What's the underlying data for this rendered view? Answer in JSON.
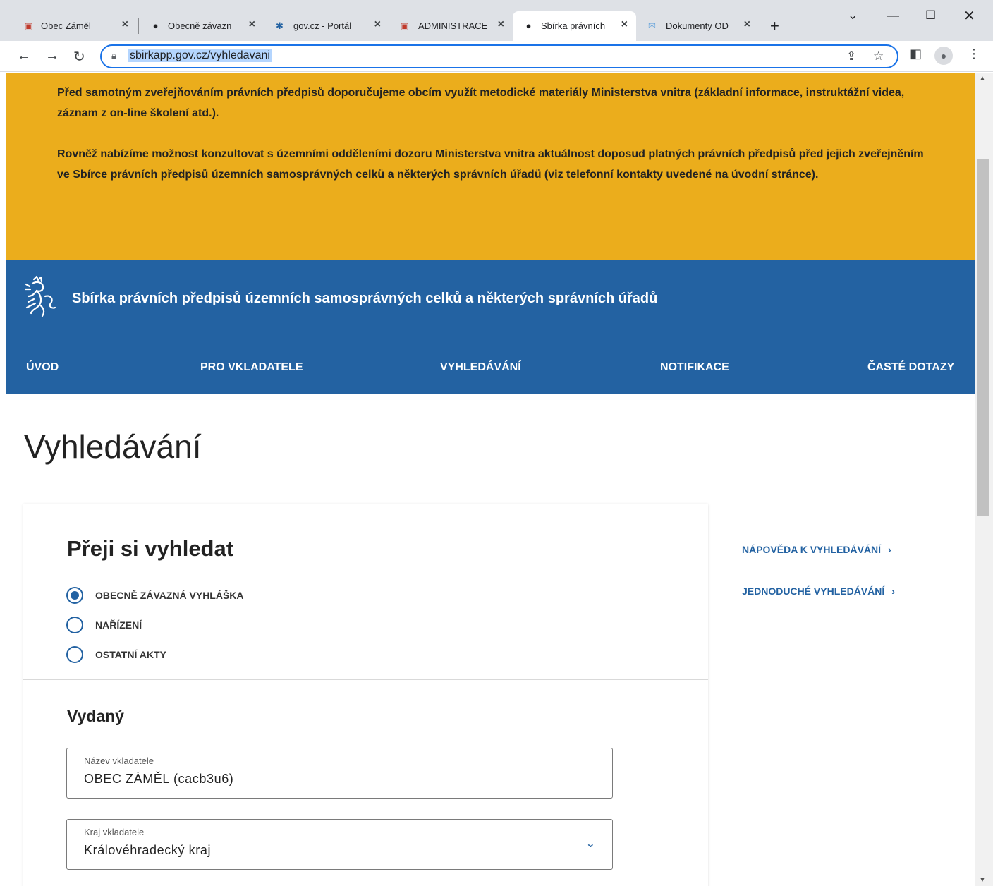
{
  "browser": {
    "tabs": [
      {
        "title": "Obec Záměl",
        "icon": "obec-icon",
        "active": false
      },
      {
        "title": "Obecně závazn",
        "icon": "globe-icon",
        "active": false
      },
      {
        "title": "gov.cz - Portál",
        "icon": "gov-icon",
        "active": false
      },
      {
        "title": "ADMINISTRACE",
        "icon": "obec-icon",
        "active": false
      },
      {
        "title": "Sbírka právních",
        "icon": "globe-icon",
        "active": true
      },
      {
        "title": "Dokumenty OD",
        "icon": "mail-icon",
        "active": false
      }
    ],
    "url": "sbirkapp.gov.cz/vyhledavani"
  },
  "notice": {
    "paragraph1": "Před samotným zveřejňováním právních předpisů doporučujeme obcím využít metodické materiály Ministerstva vnitra (základní informace, instruktážní videa, záznam z on-line školení atd.).",
    "paragraph2": "Rovněž nabízíme možnost konzultovat s územními odděleními dozoru Ministerstva vnitra aktuálnost doposud platných právních předpisů před jejich zveřejněním ve Sbírce právních předpisů územních samosprávných celků a některých správních úřadů (viz telefonní kontakty uvedené na úvodní stránce)."
  },
  "header": {
    "site_title": "Sbírka právních předpisů územních samosprávných celků a některých správních úřadů",
    "nav": [
      "ÚVOD",
      "PRO VKLADATELE",
      "VYHLEDÁVÁNÍ",
      "NOTIFIKACE",
      "ČASTÉ DOTAZY"
    ]
  },
  "main": {
    "page_title": "Vyhledávání",
    "card_title": "Přeji si vyhledat",
    "radios": [
      {
        "label": "OBECNĚ ZÁVAZNÁ VYHLÁŠKA",
        "selected": true
      },
      {
        "label": "NAŘÍZENÍ",
        "selected": false
      },
      {
        "label": "OSTATNÍ AKTY",
        "selected": false
      }
    ],
    "section_title": "Vydaný",
    "fields": {
      "submitter_name_label": "Název vkladatele",
      "submitter_name_value": "OBEC ZÁMĚL (cacb3u6)",
      "region_label": "Kraj vkladatele",
      "region_value": "Královéhradecký kraj"
    },
    "side_links": [
      "NÁPOVĚDA K VYHLEDÁVÁNÍ",
      "JEDNODUCHÉ VYHLEDÁVÁNÍ"
    ]
  },
  "colors": {
    "notice_bg": "#ebad1c",
    "header_bg": "#2362a2",
    "accent": "#2362a2"
  }
}
